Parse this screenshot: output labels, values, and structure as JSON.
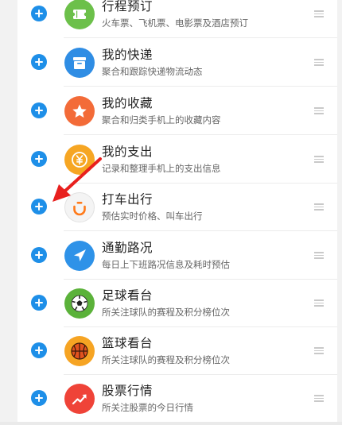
{
  "services": [
    {
      "title": "行程预订",
      "subtitle": "火车票、飞机票、电影票及酒店预订",
      "icon": "ticket-icon",
      "color": "#6cc04a"
    },
    {
      "title": "我的快递",
      "subtitle": "聚合和跟踪快递物流动态",
      "icon": "package-icon",
      "color": "#2f8de4"
    },
    {
      "title": "我的收藏",
      "subtitle": "聚合和归类手机上的收藏内容",
      "icon": "star-icon",
      "color": "#f36b38"
    },
    {
      "title": "我的支出",
      "subtitle": "记录和整理手机上的支出信息",
      "icon": "yuan-icon",
      "color": "#f6a623"
    },
    {
      "title": "打车出行",
      "subtitle": "预估实时价格、叫车出行",
      "icon": "didi-icon",
      "color": "#f4f4f4"
    },
    {
      "title": "通勤路况",
      "subtitle": "每日上下班路况信息及耗时预估",
      "icon": "navigation-arrow-icon",
      "color": "#2e92e8"
    },
    {
      "title": "足球看台",
      "subtitle": "所关注球队的赛程及积分榜位次",
      "icon": "soccer-ball-icon",
      "color": "#5bb23a"
    },
    {
      "title": "篮球看台",
      "subtitle": "所关注球队的赛程及积分榜位次",
      "icon": "basketball-icon",
      "color": "#f6a423"
    },
    {
      "title": "股票行情",
      "subtitle": "所关注股票的今日行情",
      "icon": "stock-trend-icon",
      "color": "#ef4338"
    }
  ],
  "colors": {
    "add_button": "#1e8fe8",
    "annotation_arrow": "#e8201e"
  },
  "annotation": {
    "icon": "red-arrow-icon"
  }
}
